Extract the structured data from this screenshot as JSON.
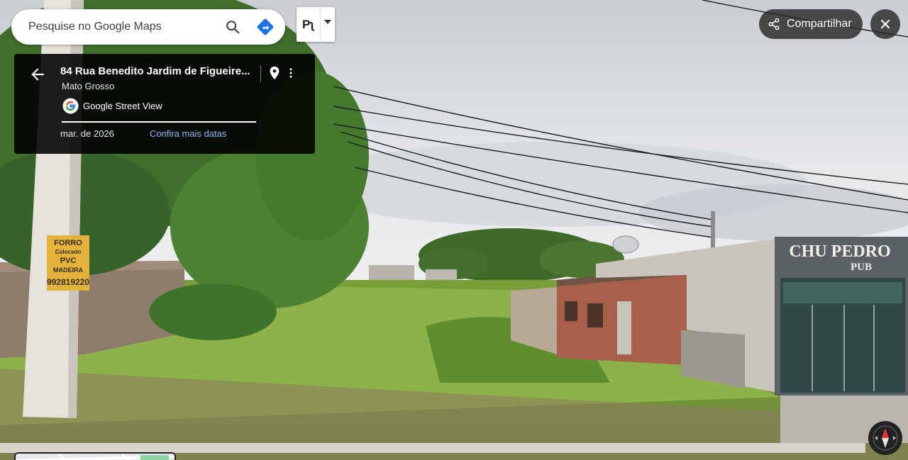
{
  "search": {
    "placeholder": "Pesquise no Google Maps"
  },
  "view_toggle": {
    "label": "Pʅ"
  },
  "info_card": {
    "address": "84 Rua Benedito Jardim de Figueire...",
    "region": "Mato Grosso",
    "source": "Google Street View",
    "date": "mar. de 2026",
    "more_dates": "Confira mais datas"
  },
  "share": {
    "label": "Compartilhar"
  },
  "scene": {
    "pole_sign": [
      "FORRO",
      "Colocado",
      "PVC",
      "MADEIRA",
      "992819220"
    ],
    "storefront_sign": [
      "CHU PEDRO",
      "PUB"
    ]
  },
  "icons": {
    "search": "search-icon",
    "directions": "directions-icon",
    "back": "arrow-back-icon",
    "pin": "location-pin-icon",
    "more": "more-vert-icon",
    "google": "google-logo-icon",
    "share": "share-icon",
    "close": "close-icon",
    "compass": "compass-icon"
  },
  "colors": {
    "link": "#8ab4f8",
    "directions": "#1a73e8",
    "compass_north": "#e53935"
  }
}
